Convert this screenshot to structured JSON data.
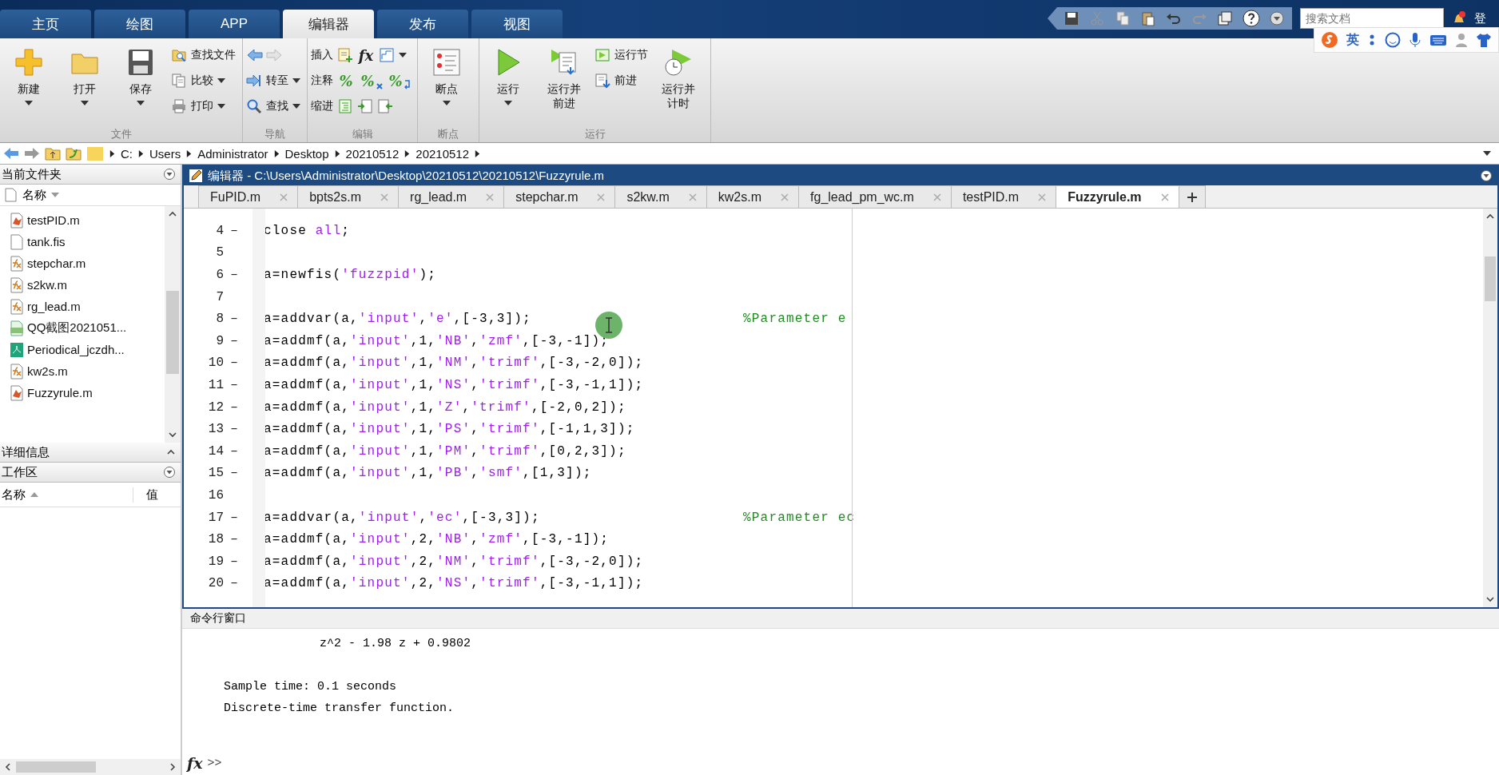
{
  "ribbon_tabs": [
    {
      "label": "主页",
      "selected": false
    },
    {
      "label": "绘图",
      "selected": false
    },
    {
      "label": "APP",
      "selected": false
    },
    {
      "label": "编辑器",
      "selected": true
    },
    {
      "label": "发布",
      "selected": false
    },
    {
      "label": "视图",
      "selected": false
    }
  ],
  "quick_access": {
    "search": {
      "placeholder": "搜索文档"
    },
    "login_text": "登"
  },
  "ime_bar": {
    "label": "英"
  },
  "ribbon_groups": [
    {
      "title": "文件",
      "items": [
        {
          "kind": "large",
          "label": "新建",
          "dropdown": true
        },
        {
          "kind": "large",
          "label": "打开",
          "dropdown": true
        },
        {
          "kind": "large",
          "label": "保存",
          "dropdown": true
        },
        {
          "kind": "stack",
          "entries": [
            {
              "label": "查找文件",
              "dropdown": false
            },
            {
              "label": "比较",
              "dropdown": true
            },
            {
              "label": "打印",
              "dropdown": true
            }
          ]
        }
      ]
    },
    {
      "title": "导航",
      "items": [
        {
          "kind": "stack",
          "entries": [
            {
              "dropdown": false
            },
            {
              "label": "转至",
              "dropdown": true
            },
            {
              "label": "查找",
              "dropdown": true
            }
          ]
        }
      ]
    },
    {
      "title": "编辑",
      "items": [
        {
          "kind": "rows",
          "rows": [
            {
              "label": "插入",
              "icons": [
                {
                  "kind": "image"
                },
                {
                  "kind": "glyph",
                  "glyph": "fx"
                },
                {
                  "kind": "image"
                }
              ],
              "dropdown": true
            },
            {
              "label": "注释",
              "icons": [
                {
                  "kind": "glyph",
                  "glyph": "%"
                },
                {
                  "kind": "uncomment",
                  "glyph": "%"
                },
                {
                  "kind": "wrap",
                  "glyph": "%"
                }
              ],
              "dropdown": false
            },
            {
              "label": "缩进",
              "icons": [
                {
                  "kind": "image"
                },
                {
                  "kind": "image"
                },
                {
                  "kind": "image"
                }
              ],
              "dropdown": false
            }
          ]
        }
      ]
    },
    {
      "title": "断点",
      "items": [
        {
          "kind": "large",
          "label": "断点",
          "dropdown": true
        }
      ]
    },
    {
      "title": "运行",
      "items": [
        {
          "kind": "large",
          "label": "运行",
          "dropdown": true
        },
        {
          "kind": "large",
          "label": "运行并前进",
          "dropdown": false
        },
        {
          "kind": "stack",
          "entries": [
            {
              "label": "运行节",
              "dropdown": false
            },
            {
              "label": "前进",
              "dropdown": false
            }
          ]
        },
        {
          "kind": "large",
          "label": "运行并计时",
          "dropdown": false
        }
      ]
    }
  ],
  "address_bar": {
    "crumbs": [
      "C:",
      "Users",
      "Administrator",
      "Desktop",
      "20210512",
      "20210512"
    ]
  },
  "current_folder": {
    "title": "当前文件夹",
    "column": "名称",
    "files": [
      {
        "name": "testPID.m",
        "kind": "script"
      },
      {
        "name": "tank.fis",
        "kind": "plain"
      },
      {
        "name": "stepchar.m",
        "kind": "function"
      },
      {
        "name": "s2kw.m",
        "kind": "function"
      },
      {
        "name": "rg_lead.m",
        "kind": "function"
      },
      {
        "name": "QQ截图2021051...",
        "kind": "png"
      },
      {
        "name": "Periodical_jczdh...",
        "kind": "pdf"
      },
      {
        "name": "kw2s.m",
        "kind": "function"
      },
      {
        "name": "Fuzzyrule.m",
        "kind": "script"
      }
    ]
  },
  "details": {
    "title": "详细信息"
  },
  "workspace": {
    "title": "工作区",
    "columns": [
      "名称",
      "值"
    ]
  },
  "editor": {
    "title": "编辑器 - C:\\Users\\Administrator\\Desktop\\20210512\\20210512\\Fuzzyrule.m",
    "tabs": [
      {
        "label": "FuPID.m",
        "selected": false
      },
      {
        "label": "bpts2s.m",
        "selected": false
      },
      {
        "label": "rg_lead.m",
        "selected": false
      },
      {
        "label": "stepchar.m",
        "selected": false
      },
      {
        "label": "s2kw.m",
        "selected": false
      },
      {
        "label": "kw2s.m",
        "selected": false
      },
      {
        "label": "fg_lead_pm_wc.m",
        "selected": false
      },
      {
        "label": "testPID.m",
        "selected": false
      },
      {
        "label": "Fuzzyrule.m",
        "selected": true
      }
    ],
    "lines": [
      {
        "number": "4",
        "marker": "–",
        "tokens": [
          {
            "kind": "code",
            "text": "close "
          },
          {
            "kind": "string",
            "text": "all"
          },
          {
            "kind": "code",
            "text": ";"
          }
        ]
      },
      {
        "number": "5"
      },
      {
        "number": "6",
        "marker": "–",
        "tokens": [
          {
            "kind": "code",
            "text": "a=newfis("
          },
          {
            "kind": "string",
            "text": "'fuzzpid'"
          },
          {
            "kind": "code",
            "text": ");"
          }
        ]
      },
      {
        "number": "7"
      },
      {
        "number": "8",
        "marker": "–",
        "tokens": [
          {
            "kind": "code",
            "text": "a=addvar(a,"
          },
          {
            "kind": "string",
            "text": "'input'"
          },
          {
            "kind": "code",
            "text": ","
          },
          {
            "kind": "string",
            "text": "'e'"
          },
          {
            "kind": "code",
            "text": ",[-3,3]);"
          }
        ],
        "comment": "%Parameter e"
      },
      {
        "number": "9",
        "marker": "–",
        "tokens": [
          {
            "kind": "code",
            "text": "a=addmf(a,"
          },
          {
            "kind": "string",
            "text": "'input'"
          },
          {
            "kind": "code",
            "text": ",1,"
          },
          {
            "kind": "string",
            "text": "'NB'"
          },
          {
            "kind": "code",
            "text": ","
          },
          {
            "kind": "string",
            "text": "'zmf'"
          },
          {
            "kind": "code",
            "text": ",[-3,-1]);"
          }
        ]
      },
      {
        "number": "10",
        "marker": "–",
        "tokens": [
          {
            "kind": "code",
            "text": "a=addmf(a,"
          },
          {
            "kind": "string",
            "text": "'input'"
          },
          {
            "kind": "code",
            "text": ",1,"
          },
          {
            "kind": "string",
            "text": "'NM'"
          },
          {
            "kind": "code",
            "text": ","
          },
          {
            "kind": "string",
            "text": "'trimf'"
          },
          {
            "kind": "code",
            "text": ",[-3,-2,0]);"
          }
        ]
      },
      {
        "number": "11",
        "marker": "–",
        "tokens": [
          {
            "kind": "code",
            "text": "a=addmf(a,"
          },
          {
            "kind": "string",
            "text": "'input'"
          },
          {
            "kind": "code",
            "text": ",1,"
          },
          {
            "kind": "string",
            "text": "'NS'"
          },
          {
            "kind": "code",
            "text": ","
          },
          {
            "kind": "string",
            "text": "'trimf'"
          },
          {
            "kind": "code",
            "text": ",[-3,-1,1]);"
          }
        ]
      },
      {
        "number": "12",
        "marker": "–",
        "tokens": [
          {
            "kind": "code",
            "text": "a=addmf(a,"
          },
          {
            "kind": "string",
            "text": "'input'"
          },
          {
            "kind": "code",
            "text": ",1,"
          },
          {
            "kind": "string",
            "text": "'Z'"
          },
          {
            "kind": "code",
            "text": ","
          },
          {
            "kind": "string",
            "text": "'trimf'"
          },
          {
            "kind": "code",
            "text": ",[-2,0,2]);"
          }
        ]
      },
      {
        "number": "13",
        "marker": "–",
        "tokens": [
          {
            "kind": "code",
            "text": "a=addmf(a,"
          },
          {
            "kind": "string",
            "text": "'input'"
          },
          {
            "kind": "code",
            "text": ",1,"
          },
          {
            "kind": "string",
            "text": "'PS'"
          },
          {
            "kind": "code",
            "text": ","
          },
          {
            "kind": "string",
            "text": "'trimf'"
          },
          {
            "kind": "code",
            "text": ",[-1,1,3]);"
          }
        ]
      },
      {
        "number": "14",
        "marker": "–",
        "tokens": [
          {
            "kind": "code",
            "text": "a=addmf(a,"
          },
          {
            "kind": "string",
            "text": "'input'"
          },
          {
            "kind": "code",
            "text": ",1,"
          },
          {
            "kind": "string",
            "text": "'PM'"
          },
          {
            "kind": "code",
            "text": ","
          },
          {
            "kind": "string",
            "text": "'trimf'"
          },
          {
            "kind": "code",
            "text": ",[0,2,3]);"
          }
        ]
      },
      {
        "number": "15",
        "marker": "–",
        "tokens": [
          {
            "kind": "code",
            "text": "a=addmf(a,"
          },
          {
            "kind": "string",
            "text": "'input'"
          },
          {
            "kind": "code",
            "text": ",1,"
          },
          {
            "kind": "string",
            "text": "'PB'"
          },
          {
            "kind": "code",
            "text": ","
          },
          {
            "kind": "string",
            "text": "'smf'"
          },
          {
            "kind": "code",
            "text": ",[1,3]);"
          }
        ]
      },
      {
        "number": "16"
      },
      {
        "number": "17",
        "marker": "–",
        "tokens": [
          {
            "kind": "code",
            "text": "a=addvar(a,"
          },
          {
            "kind": "string",
            "text": "'input'"
          },
          {
            "kind": "code",
            "text": ","
          },
          {
            "kind": "string",
            "text": "'ec'"
          },
          {
            "kind": "code",
            "text": ",[-3,3]);"
          }
        ],
        "comment": "%Parameter ec"
      },
      {
        "number": "18",
        "marker": "–",
        "tokens": [
          {
            "kind": "code",
            "text": "a=addmf(a,"
          },
          {
            "kind": "string",
            "text": "'input'"
          },
          {
            "kind": "code",
            "text": ",2,"
          },
          {
            "kind": "string",
            "text": "'NB'"
          },
          {
            "kind": "code",
            "text": ","
          },
          {
            "kind": "string",
            "text": "'zmf'"
          },
          {
            "kind": "code",
            "text": ",[-3,-1]);"
          }
        ]
      },
      {
        "number": "19",
        "marker": "–",
        "tokens": [
          {
            "kind": "code",
            "text": "a=addmf(a,"
          },
          {
            "kind": "string",
            "text": "'input'"
          },
          {
            "kind": "code",
            "text": ",2,"
          },
          {
            "kind": "string",
            "text": "'NM'"
          },
          {
            "kind": "code",
            "text": ","
          },
          {
            "kind": "string",
            "text": "'trimf'"
          },
          {
            "kind": "code",
            "text": ",[-3,-2,0]);"
          }
        ]
      },
      {
        "number": "20",
        "marker": "–",
        "tokens": [
          {
            "kind": "code",
            "text": "a=addmf(a,"
          },
          {
            "kind": "string",
            "text": "'input'"
          },
          {
            "kind": "code",
            "text": ",2,"
          },
          {
            "kind": "string",
            "text": "'NS'"
          },
          {
            "kind": "code",
            "text": ","
          },
          {
            "kind": "string",
            "text": "'trimf'"
          },
          {
            "kind": "code",
            "text": ",[-3,-1,1]);"
          }
        ]
      }
    ]
  },
  "command_window": {
    "title": "命令行窗口",
    "lines": [
      {
        "kind": "indented",
        "text": "z^2 - 1.98 z + 0.9802"
      },
      {
        "kind": "blank"
      },
      {
        "kind": "plain",
        "text": "Sample time: 0.1 seconds"
      },
      {
        "kind": "plain",
        "text": "Discrete-time transfer function."
      }
    ],
    "function_button": "fx",
    "prompt": ">>"
  }
}
